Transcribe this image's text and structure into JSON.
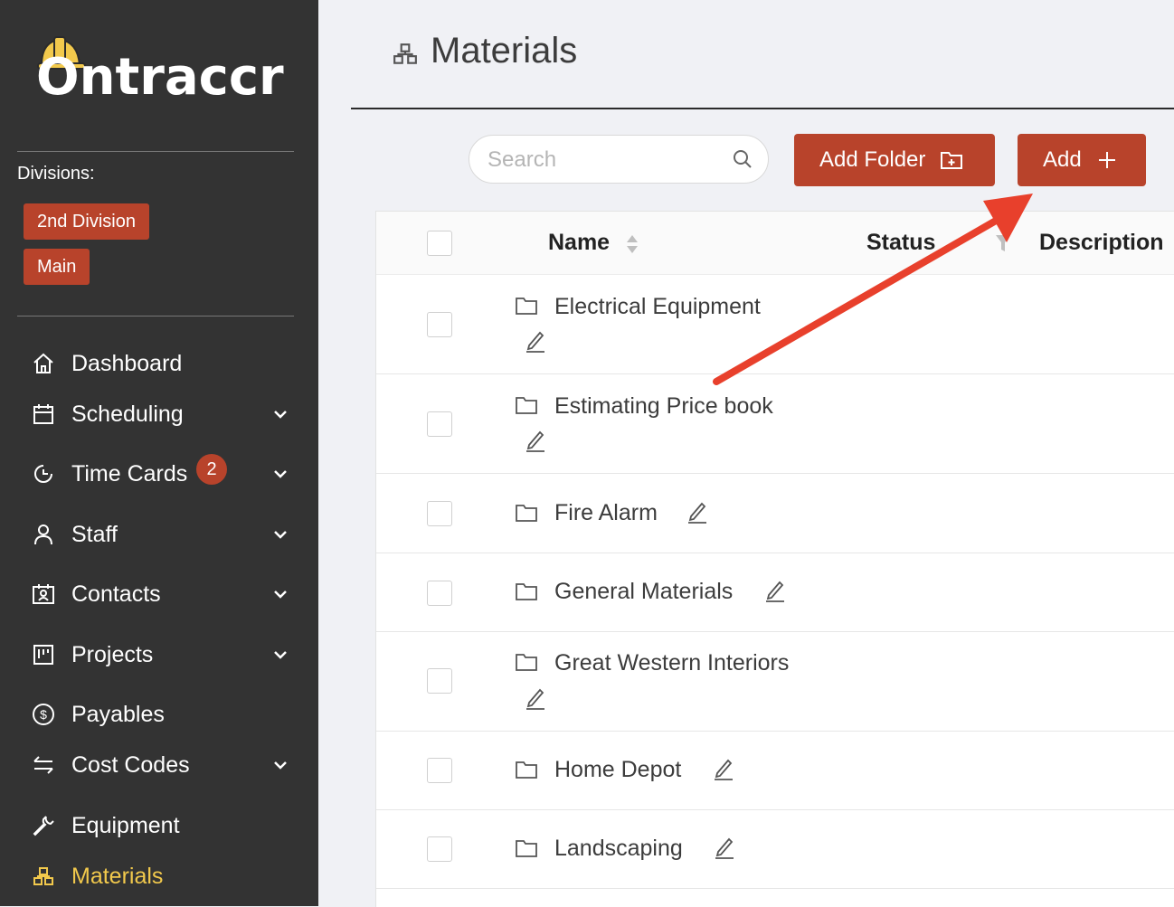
{
  "app": {
    "brand": "Ontraccr",
    "divisions_label": "Divisions:",
    "divisions": [
      "2nd Division",
      "Main"
    ]
  },
  "nav": [
    {
      "label": "Dashboard",
      "icon": "home-icon",
      "chevron": false
    },
    {
      "label": "Scheduling",
      "icon": "calendar-icon",
      "chevron": true
    },
    {
      "label": "Time Cards",
      "icon": "clock-icon",
      "chevron": true,
      "badge": "2"
    },
    {
      "label": "Staff",
      "icon": "user-icon",
      "chevron": true
    },
    {
      "label": "Contacts",
      "icon": "contact-card-icon",
      "chevron": true
    },
    {
      "label": "Projects",
      "icon": "project-board-icon",
      "chevron": true
    },
    {
      "label": "Payables",
      "icon": "dollar-icon",
      "chevron": false
    },
    {
      "label": "Cost Codes",
      "icon": "swap-icon",
      "chevron": true
    },
    {
      "label": "Equipment",
      "icon": "wrench-icon",
      "chevron": false
    },
    {
      "label": "Materials",
      "icon": "materials-icon",
      "chevron": false,
      "active": true
    }
  ],
  "page": {
    "title": "Materials",
    "search_placeholder": "Search",
    "add_folder_label": "Add Folder",
    "add_label": "Add"
  },
  "table": {
    "columns": [
      "Name",
      "Status",
      "Description"
    ],
    "rows": [
      {
        "name": "Electrical Equipment"
      },
      {
        "name": "Estimating Price book"
      },
      {
        "name": "Fire Alarm"
      },
      {
        "name": "General Materials"
      },
      {
        "name": "Great Western Interiors"
      },
      {
        "name": "Home Depot"
      },
      {
        "name": "Landscaping"
      }
    ]
  },
  "colors": {
    "sidebar_bg": "#333333",
    "accent": "#b8432b",
    "active_nav": "#f2c94c",
    "annotation_arrow": "#e8402c"
  }
}
